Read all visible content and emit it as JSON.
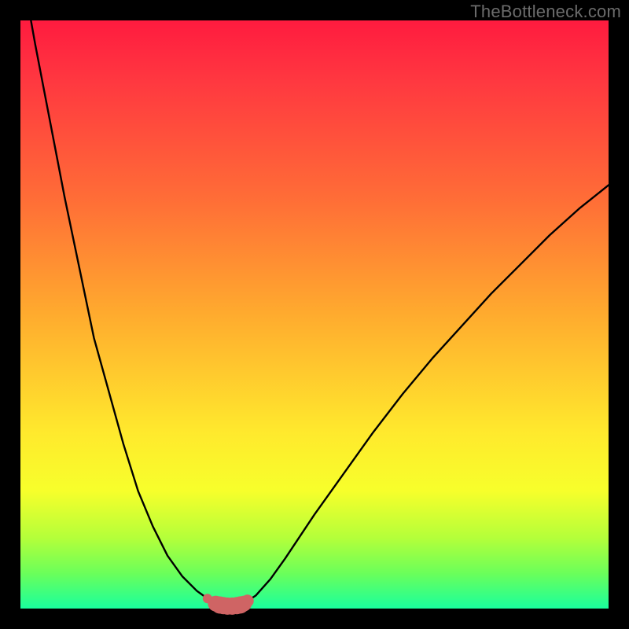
{
  "watermark": "TheBottleneck.com",
  "colors": {
    "background": "#000000",
    "curve_stroke": "#000000",
    "dot_fill": "#cf6464",
    "gradient_top": "#ff1b3f",
    "gradient_bottom": "#19ff9d"
  },
  "chart_data": {
    "type": "line",
    "title": "",
    "xlabel": "",
    "ylabel": "",
    "xlim": [
      0,
      100
    ],
    "ylim": [
      0,
      100
    ],
    "x": [
      0,
      2.5,
      5,
      7.5,
      10,
      12.5,
      15,
      17.5,
      20,
      22.5,
      25,
      27.5,
      30,
      32.5,
      33,
      33.5,
      34,
      35,
      36,
      37,
      37.5,
      38,
      40,
      42.5,
      45,
      50,
      55,
      60,
      65,
      70,
      75,
      80,
      85,
      90,
      95,
      100
    ],
    "values": [
      110,
      96,
      83,
      70,
      58,
      46,
      37,
      28,
      20,
      14,
      9,
      5.5,
      3,
      1.2,
      0.9,
      0.7,
      0.55,
      0.4,
      0.4,
      0.55,
      0.7,
      0.9,
      2.2,
      5,
      8.5,
      16,
      23,
      30,
      36.5,
      42.5,
      48,
      53.5,
      58.5,
      63.5,
      68,
      72
    ],
    "markers": {
      "x": [
        31.8,
        33.2,
        33.9,
        34.5,
        35.2,
        36.0,
        36.8,
        37.4,
        38.0,
        38.6
      ],
      "y": [
        1.7,
        0.85,
        0.6,
        0.5,
        0.42,
        0.42,
        0.5,
        0.62,
        0.85,
        1.3
      ],
      "size": [
        6,
        10,
        11,
        11,
        11,
        11,
        11,
        11,
        10,
        8
      ]
    }
  }
}
